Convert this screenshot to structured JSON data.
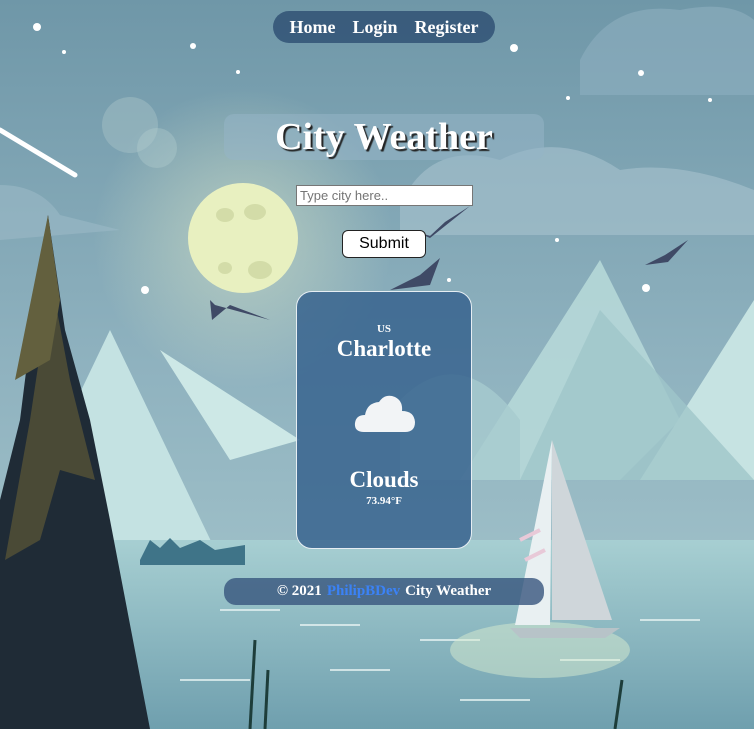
{
  "nav": {
    "items": [
      "Home",
      "Login",
      "Register"
    ]
  },
  "header": {
    "title": "City Weather"
  },
  "search": {
    "placeholder": "Type city here..",
    "value": "",
    "submit_label": "Submit"
  },
  "weather": {
    "country": "US",
    "city": "Charlotte",
    "icon": "cloud-icon",
    "condition": "Clouds",
    "temperature": "73.94°F"
  },
  "footer": {
    "copyright": "© 2021",
    "author": "PhilipBDev",
    "suffix": "City Weather"
  },
  "colors": {
    "accent_link": "#3b82f6",
    "card_bg": "#34608c",
    "nav_bg": "#28486e"
  }
}
